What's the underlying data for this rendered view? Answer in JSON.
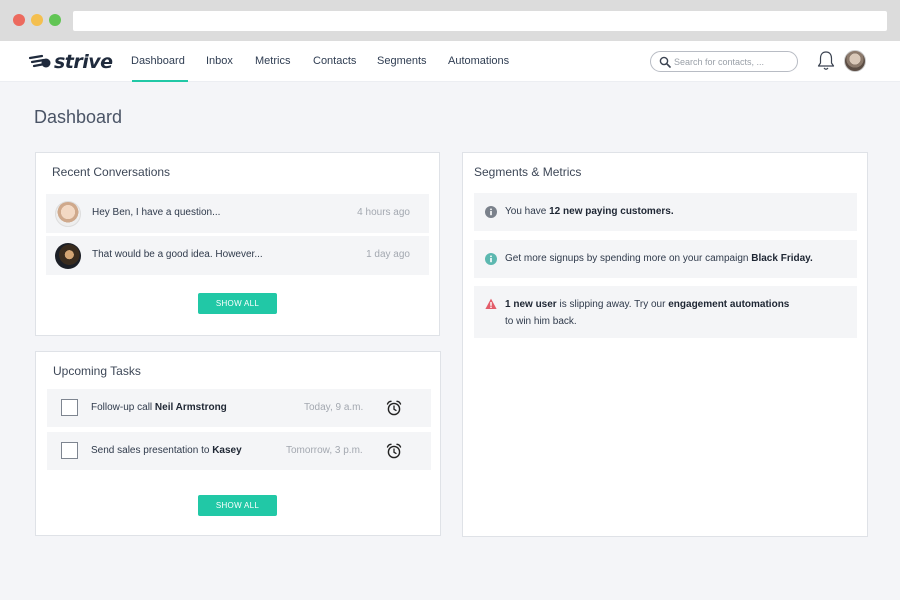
{
  "brand": {
    "name": "strive"
  },
  "nav": {
    "items": [
      {
        "label": "Dashboard",
        "active": true
      },
      {
        "label": "Inbox"
      },
      {
        "label": "Metrics"
      },
      {
        "label": "Contacts"
      },
      {
        "label": "Segments"
      },
      {
        "label": "Automations"
      }
    ],
    "search_placeholder": "Search for contacts, ..."
  },
  "page_title": "Dashboard",
  "conversations": {
    "title": "Recent Conversations",
    "items": [
      {
        "text": "Hey Ben, I have a question...",
        "time": "4 hours ago"
      },
      {
        "text": "That would be a good idea. However...",
        "time": "1 day ago"
      }
    ],
    "button": "SHOW ALL"
  },
  "tasks": {
    "title": "Upcoming Tasks",
    "items": [
      {
        "prefix": "Follow-up call",
        "name": "Neil Armstrong",
        "time": "Today, 9 a.m."
      },
      {
        "prefix": "Send sales presentation to",
        "name": "Kasey",
        "time": "Tomorrow, 3 p.m."
      }
    ],
    "button": "SHOW ALL"
  },
  "metrics": {
    "title": "Segments & Metrics",
    "items": [
      {
        "icon": "info-icon",
        "color": "#7a818b",
        "pre": "You have",
        "bold": "12 new paying customers.",
        "post": ""
      },
      {
        "icon": "info-icon",
        "color": "#5cb8b0",
        "pre": "Get more signups by spending more on your campaign",
        "bold": "Black Friday.",
        "post": ""
      },
      {
        "icon": "warning-icon",
        "color": "#e35d6a",
        "bold1": "1 new user",
        "mid": "is slipping away. Try our",
        "bold2": "engagement automations",
        "line2": "to win him back."
      }
    ]
  },
  "colors": {
    "accent": "#21c8a6",
    "text": "#2f3a4b",
    "muted": "#a3a8b0"
  }
}
